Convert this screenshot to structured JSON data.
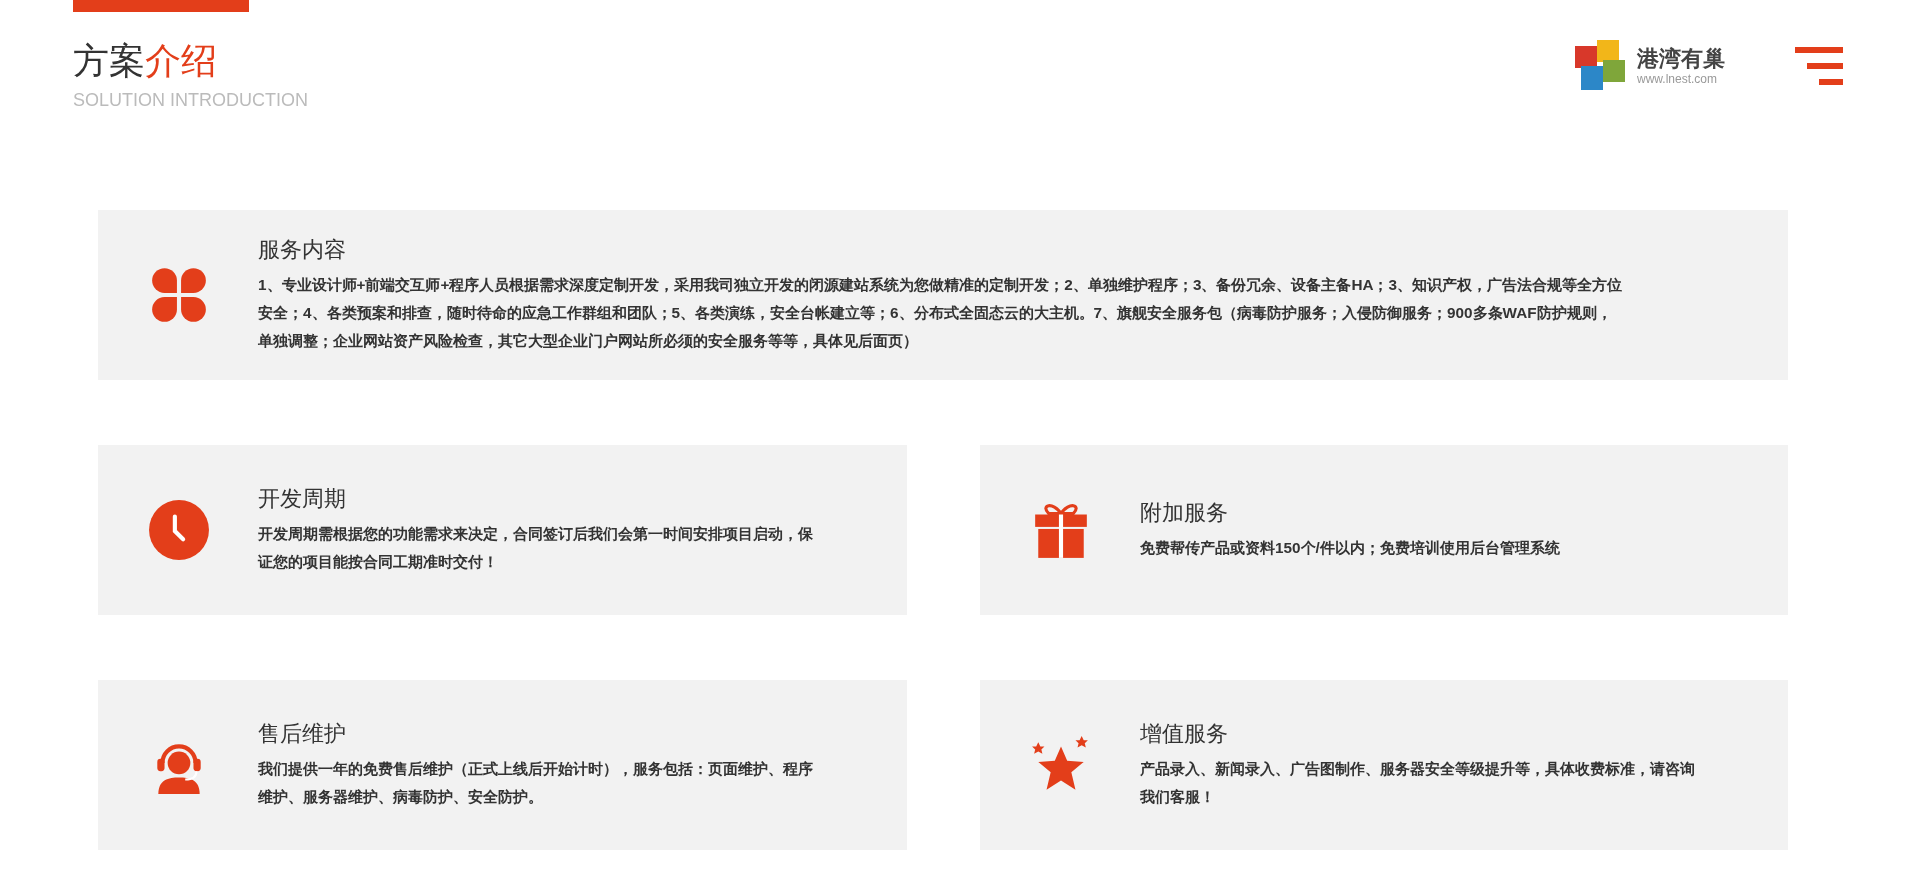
{
  "header": {
    "title_plain": "方案",
    "title_accent": "介绍",
    "subtitle": "SOLUTION INTRODUCTION"
  },
  "logo": {
    "name": "港湾有巢",
    "url": "www.lnest.com"
  },
  "cards": [
    {
      "kind": "clover",
      "title": "服务内容",
      "text": "1、专业设计师+前端交互师+程序人员根据需求深度定制开发，采用我司独立开发的闭源建站系统为您做精准的定制开发；2、单独维护程序；3、备份冗余、设备主备HA；3、知识产权，广告法合规等全方位安全；4、各类预案和排查，随时待命的应急工作群组和团队；5、各类演练，安全台帐建立等；6、分布式全固态云的大主机。7、旗舰安全服务包（病毒防护服务；入侵防御服务；900多条WAF防护规则，单独调整；企业网站资产风险检查，其它大型企业门户网站所必须的安全服务等等，具体见后面页）"
    },
    {
      "kind": "clock",
      "title": "开发周期",
      "text": "开发周期需根据您的功能需求来决定，合同签订后我们会第一时间安排项目启动，保证您的项目能按合同工期准时交付！"
    },
    {
      "kind": "gift",
      "title": "附加服务",
      "text": "免费帮传产品或资料150个/件以内；免费培训使用后台管理系统"
    },
    {
      "kind": "headset",
      "title": "售后维护",
      "text": "我们提供一年的免费售后维护（正式上线后开始计时），服务包括：页面维护、程序维护、服务器维护、病毒防护、安全防护。"
    },
    {
      "kind": "star",
      "title": "增值服务",
      "text": "产品录入、新闻录入、广告图制作、服务器安全等级提升等，具体收费标准，请咨询我们客服！"
    }
  ]
}
